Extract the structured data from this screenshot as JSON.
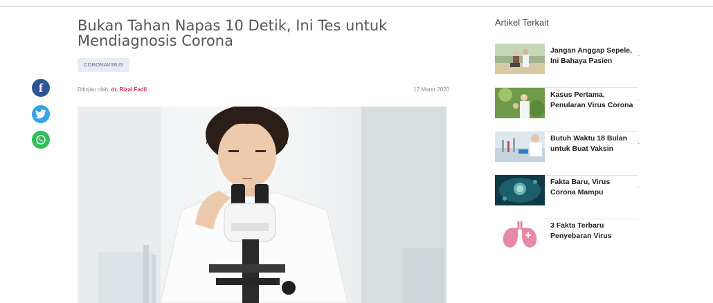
{
  "article": {
    "title": "Bukan Tahan Napas 10 Detik, Ini Tes untuk Mendiagnosis Corona",
    "tag": "CORONAVIRUS",
    "reviewed_label": "Ditinjau oleh:",
    "reviewer": "dr. Rizal Fadli",
    "date": "17 Maret 2020"
  },
  "social": {
    "facebook_glyph": "f",
    "icons": [
      "facebook-icon",
      "twitter-icon",
      "whatsapp-icon"
    ]
  },
  "sidebar": {
    "title": "Artikel Terkait",
    "items": [
      {
        "text": "Jangan Anggap Sepele, Ini Bahaya Pasien"
      },
      {
        "text": "Kasus Pertama, Penularan Virus Corona"
      },
      {
        "text": "Butuh Waktu 18 Bulan untuk Buat Vaksin"
      },
      {
        "text": "Fakta Baru, Virus Corona Mampu"
      },
      {
        "text": "3 Fakta Terbaru Penyebaran Virus"
      }
    ],
    "ellipsis": "."
  },
  "colors": {
    "facebook": "#2f5597",
    "twitter": "#35a2e8",
    "whatsapp": "#2fc05a",
    "reviewer_link": "#d6304c",
    "tag_bg": "#e8ecf4"
  }
}
